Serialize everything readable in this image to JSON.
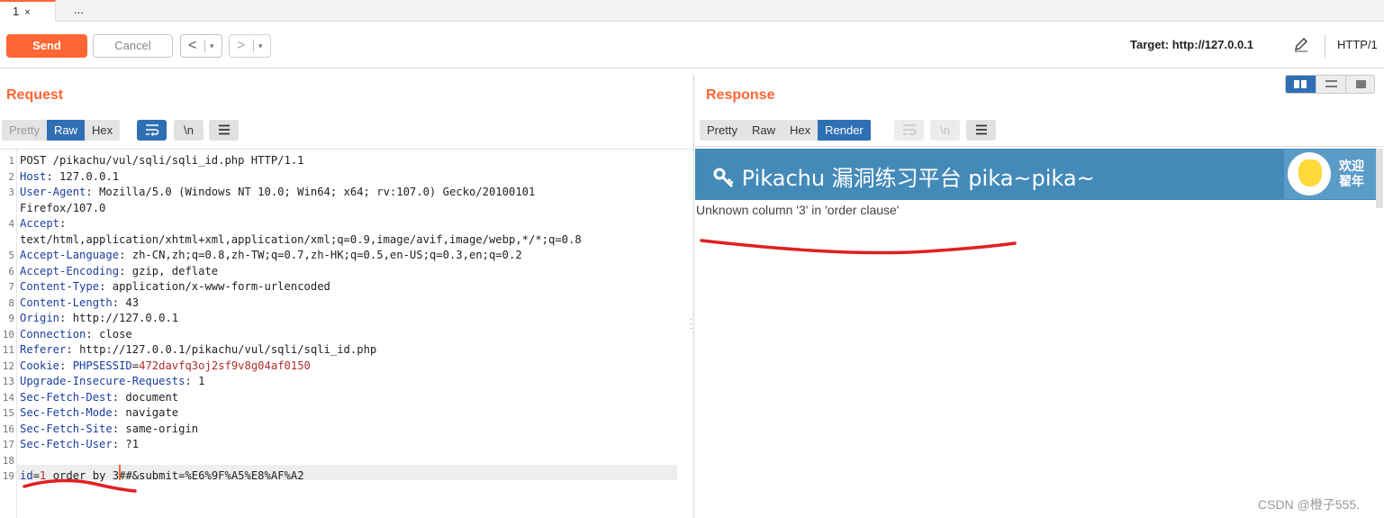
{
  "tabs": [
    {
      "label": "1",
      "close": "×"
    },
    {
      "label": "..."
    }
  ],
  "toolbar": {
    "send_label": "Send",
    "cancel_label": "Cancel",
    "back_label": "<",
    "forward_label": ">",
    "dropdown_glyph": "▾",
    "target_label": "Target: http://127.0.0.1",
    "http_version": "HTTP/1"
  },
  "request": {
    "title": "Request",
    "view_modes": [
      "Pretty",
      "Raw",
      "Hex"
    ],
    "active_mode": "Raw",
    "newline_label": "\\n",
    "lines": [
      {
        "n": "1",
        "key": "",
        "sep": "",
        "val": "POST /pikachu/vul/sqli/sqli_id.php HTTP/1.1"
      },
      {
        "n": "2",
        "key": "Host",
        "sep": ": ",
        "val": "127.0.0.1"
      },
      {
        "n": "3",
        "key": "User-Agent",
        "sep": ": ",
        "val": "Mozilla/5.0 (Windows NT 10.0; Win64; x64; rv:107.0) Gecko/20100101"
      },
      {
        "n": "",
        "key": "",
        "sep": "",
        "val": "Firefox/107.0"
      },
      {
        "n": "4",
        "key": "Accept",
        "sep": ":",
        "val": ""
      },
      {
        "n": "",
        "key": "",
        "sep": "",
        "val": "text/html,application/xhtml+xml,application/xml;q=0.9,image/avif,image/webp,*/*;q=0.8"
      },
      {
        "n": "5",
        "key": "Accept-Language",
        "sep": ": ",
        "val": "zh-CN,zh;q=0.8,zh-TW;q=0.7,zh-HK;q=0.5,en-US;q=0.3,en;q=0.2"
      },
      {
        "n": "6",
        "key": "Accept-Encoding",
        "sep": ": ",
        "val": "gzip, deflate"
      },
      {
        "n": "7",
        "key": "Content-Type",
        "sep": ": ",
        "val": "application/x-www-form-urlencoded"
      },
      {
        "n": "8",
        "key": "Content-Length",
        "sep": ": ",
        "val": "43"
      },
      {
        "n": "9",
        "key": "Origin",
        "sep": ": ",
        "val": "http://127.0.0.1"
      },
      {
        "n": "10",
        "key": "Connection",
        "sep": ": ",
        "val": "close"
      },
      {
        "n": "11",
        "key": "Referer",
        "sep": ": ",
        "val": "http://127.0.0.1/pikachu/vul/sqli/sqli_id.php"
      },
      {
        "n": "12",
        "key": "Cookie",
        "sep": ": ",
        "val": ""
      },
      {
        "n": "13",
        "key": "Upgrade-Insecure-Requests",
        "sep": ": ",
        "val": "1"
      },
      {
        "n": "14",
        "key": "Sec-Fetch-Dest",
        "sep": ": ",
        "val": "document"
      },
      {
        "n": "15",
        "key": "Sec-Fetch-Mode",
        "sep": ": ",
        "val": "navigate"
      },
      {
        "n": "16",
        "key": "Sec-Fetch-Site",
        "sep": ": ",
        "val": "same-origin"
      },
      {
        "n": "17",
        "key": "Sec-Fetch-User",
        "sep": ": ",
        "val": "?1"
      },
      {
        "n": "18",
        "key": "",
        "sep": "",
        "val": ""
      },
      {
        "n": "19",
        "key": "",
        "sep": "",
        "val": ""
      }
    ],
    "cookie": {
      "name": "PHPSESSID",
      "eq": "=",
      "value": "472davfq3oj2sf9v8g04af0150"
    },
    "body": {
      "param": "id",
      "eq": "=",
      "num": "1",
      "rest": " order by 3",
      "tail": "##&submit=%E6%9F%A5%E8%AF%A2"
    }
  },
  "response": {
    "title": "Response",
    "view_modes": [
      "Pretty",
      "Raw",
      "Hex",
      "Render"
    ],
    "active_mode": "Render",
    "newline_label": "\\n",
    "page": {
      "header_title": "Pikachu 漏洞练习平台 pika~pika~",
      "welcome_line1": "欢迎",
      "welcome_line2": "翟年",
      "error_text": "Unknown column '3' in 'order clause'"
    }
  },
  "watermark": "CSDN @橙子555.",
  "colors": {
    "accent": "#ff6633",
    "selected": "#2f6fb4",
    "header_blue": "#448ab9",
    "annotation": "#e02020"
  }
}
